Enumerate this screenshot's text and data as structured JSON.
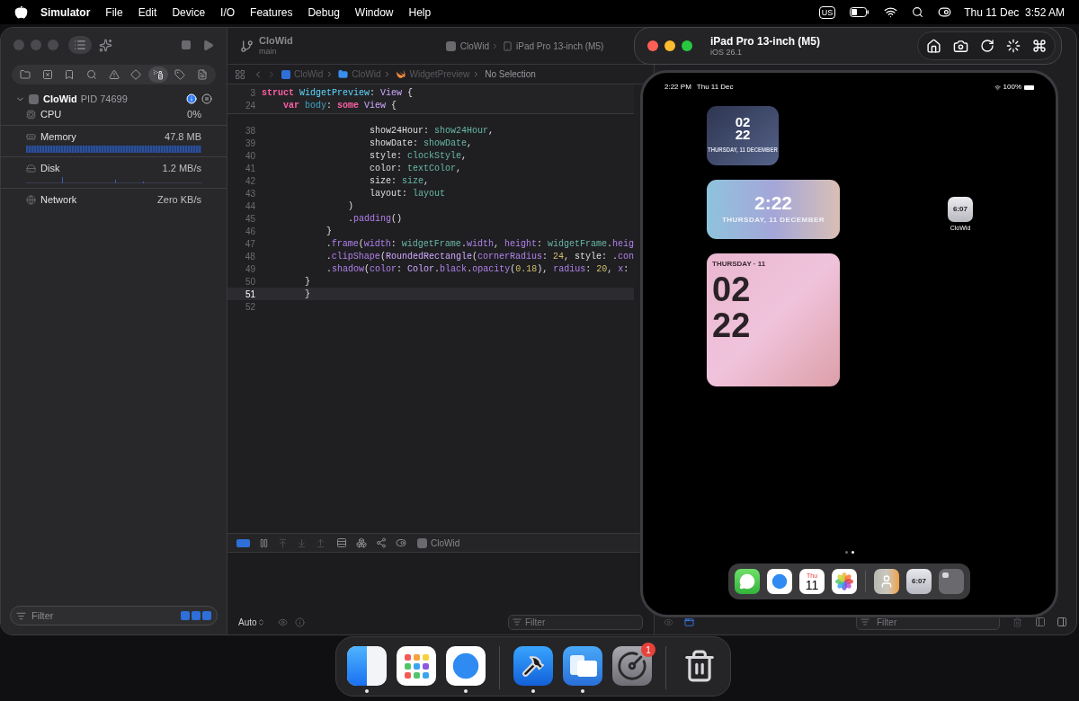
{
  "menu_bar": {
    "app_name": "Simulator",
    "menus": [
      "File",
      "Edit",
      "Device",
      "I/O",
      "Features",
      "Debug",
      "Window",
      "Help"
    ],
    "input_source": "US",
    "clock": "Thu 11 Dec  3:52 AM"
  },
  "xcode": {
    "navigator_tabs": [
      {
        "kind": "folder",
        "selected": false
      },
      {
        "kind": "source",
        "selected": false
      },
      {
        "kind": "bookmark",
        "selected": false
      },
      {
        "kind": "search",
        "selected": false
      },
      {
        "kind": "issue",
        "selected": false
      },
      {
        "kind": "test",
        "selected": false
      },
      {
        "kind": "debug",
        "selected": true
      },
      {
        "kind": "breakpoint",
        "selected": false
      },
      {
        "kind": "report",
        "selected": false
      }
    ],
    "process": {
      "name": "CloWid",
      "pid": "PID 74699",
      "expanded": true
    },
    "gauges": [
      {
        "name": "CPU",
        "value": "0%",
        "kind": "plain"
      },
      {
        "name": "Memory",
        "value": "47.8 MB",
        "kind": "bar"
      },
      {
        "name": "Disk",
        "value": "1.2 MB/s",
        "kind": "spikes"
      },
      {
        "name": "Network",
        "value": "Zero KB/s",
        "kind": "plain"
      }
    ],
    "navigator_filter": {
      "placeholder": "Filter"
    },
    "toolbar": {
      "project": "CloWid",
      "branch": "main",
      "scheme": "CloWid",
      "destination": "iPad Pro 13-inch (M5)"
    },
    "jump_bar": [
      {
        "kind": "project",
        "label": "CloWid"
      },
      {
        "kind": "folder",
        "label": "CloWid"
      },
      {
        "kind": "swift",
        "label": "WidgetPreview"
      },
      {
        "kind": "none",
        "label": "No Selection"
      }
    ],
    "sticky_lines": [
      {
        "number": "3",
        "segments": [
          {
            "kind": "keyword",
            "text": "struct "
          },
          {
            "kind": "decl",
            "text": "WidgetPreview"
          },
          {
            "kind": "plain",
            "text": ": "
          },
          {
            "kind": "type",
            "text": "View"
          },
          {
            "kind": "plain",
            "text": " {"
          }
        ]
      },
      {
        "number": "24",
        "segments": [
          {
            "kind": "keyword",
            "text": "    var "
          },
          {
            "kind": "var",
            "text": "body"
          },
          {
            "kind": "plain",
            "text": ": "
          },
          {
            "kind": "keyword",
            "text": "some "
          },
          {
            "kind": "type",
            "text": "View"
          },
          {
            "kind": "plain",
            "text": " {"
          }
        ]
      }
    ],
    "lines": [
      {
        "number": "38",
        "current": false,
        "segments": [
          {
            "kind": "plain",
            "text": "                    show24Hour: "
          },
          {
            "kind": "project",
            "text": "show24Hour"
          },
          {
            "kind": "plain",
            "text": ","
          }
        ]
      },
      {
        "number": "39",
        "current": false,
        "segments": [
          {
            "kind": "plain",
            "text": "                    showDate: "
          },
          {
            "kind": "project",
            "text": "showDate"
          },
          {
            "kind": "plain",
            "text": ","
          }
        ]
      },
      {
        "number": "40",
        "current": false,
        "segments": [
          {
            "kind": "plain",
            "text": "                    style: "
          },
          {
            "kind": "project",
            "text": "clockStyle"
          },
          {
            "kind": "plain",
            "text": ","
          }
        ]
      },
      {
        "number": "41",
        "current": false,
        "segments": [
          {
            "kind": "plain",
            "text": "                    color: "
          },
          {
            "kind": "project",
            "text": "textColor"
          },
          {
            "kind": "plain",
            "text": ","
          }
        ]
      },
      {
        "number": "42",
        "current": false,
        "segments": [
          {
            "kind": "plain",
            "text": "                    size: "
          },
          {
            "kind": "project",
            "text": "size"
          },
          {
            "kind": "plain",
            "text": ","
          }
        ]
      },
      {
        "number": "43",
        "current": false,
        "segments": [
          {
            "kind": "plain",
            "text": "                    layout: "
          },
          {
            "kind": "project",
            "text": "layout"
          }
        ]
      },
      {
        "number": "44",
        "current": false,
        "segments": [
          {
            "kind": "plain",
            "text": "                )"
          }
        ]
      },
      {
        "number": "45",
        "current": false,
        "segments": [
          {
            "kind": "plain",
            "text": "                ."
          },
          {
            "kind": "method",
            "text": "padding"
          },
          {
            "kind": "plain",
            "text": "()"
          }
        ]
      },
      {
        "number": "46",
        "current": false,
        "segments": [
          {
            "kind": "plain",
            "text": "            }"
          }
        ]
      },
      {
        "number": "47",
        "current": false,
        "segments": [
          {
            "kind": "plain",
            "text": "            ."
          },
          {
            "kind": "method",
            "text": "frame"
          },
          {
            "kind": "plain",
            "text": "("
          },
          {
            "kind": "method",
            "text": "width"
          },
          {
            "kind": "plain",
            "text": ": "
          },
          {
            "kind": "project",
            "text": "widgetFrame"
          },
          {
            "kind": "plain",
            "text": "."
          },
          {
            "kind": "method",
            "text": "width"
          },
          {
            "kind": "plain",
            "text": ", "
          },
          {
            "kind": "method",
            "text": "height"
          },
          {
            "kind": "plain",
            "text": ": "
          },
          {
            "kind": "project",
            "text": "widgetFrame"
          },
          {
            "kind": "plain",
            "text": "."
          },
          {
            "kind": "method",
            "text": "heig"
          }
        ]
      },
      {
        "number": "48",
        "current": false,
        "segments": [
          {
            "kind": "plain",
            "text": "            ."
          },
          {
            "kind": "method",
            "text": "clipShape"
          },
          {
            "kind": "plain",
            "text": "("
          },
          {
            "kind": "type",
            "text": "RoundedRectangle"
          },
          {
            "kind": "plain",
            "text": "("
          },
          {
            "kind": "method",
            "text": "cornerRadius"
          },
          {
            "kind": "plain",
            "text": ": "
          },
          {
            "kind": "number",
            "text": "24"
          },
          {
            "kind": "plain",
            "text": ", style: ."
          },
          {
            "kind": "method",
            "text": "con"
          }
        ]
      },
      {
        "number": "49",
        "current": false,
        "segments": [
          {
            "kind": "plain",
            "text": "            ."
          },
          {
            "kind": "method",
            "text": "shadow"
          },
          {
            "kind": "plain",
            "text": "("
          },
          {
            "kind": "method",
            "text": "color"
          },
          {
            "kind": "plain",
            "text": ": "
          },
          {
            "kind": "type",
            "text": "Color"
          },
          {
            "kind": "plain",
            "text": "."
          },
          {
            "kind": "method",
            "text": "black"
          },
          {
            "kind": "plain",
            "text": "."
          },
          {
            "kind": "method",
            "text": "opacity"
          },
          {
            "kind": "plain",
            "text": "("
          },
          {
            "kind": "number",
            "text": "0.18"
          },
          {
            "kind": "plain",
            "text": "), "
          },
          {
            "kind": "method",
            "text": "radius"
          },
          {
            "kind": "plain",
            "text": ": "
          },
          {
            "kind": "number",
            "text": "20"
          },
          {
            "kind": "plain",
            "text": ", "
          },
          {
            "kind": "method",
            "text": "x"
          },
          {
            "kind": "plain",
            "text": ":"
          }
        ]
      },
      {
        "number": "50",
        "current": false,
        "segments": [
          {
            "kind": "plain",
            "text": "        }"
          }
        ]
      },
      {
        "number": "51",
        "current": true,
        "segments": [
          {
            "kind": "plain",
            "text": "        }"
          }
        ]
      },
      {
        "number": "52",
        "current": false
      }
    ],
    "debug_bar": {
      "breakpoints_on": true,
      "target": "CloWid"
    },
    "console": {
      "mode": "Auto",
      "filter_placeholder": "Filter"
    },
    "variables": {
      "filter_placeholder": "Filter"
    }
  },
  "simulator": {
    "device": "iPad Pro 13-inch (M5)",
    "os": "iOS 26.1",
    "status_time": "2:22 PM",
    "status_date": "Thu 11 Dec",
    "battery": "100%",
    "widgets": [
      {
        "kind": "small",
        "hour": "02",
        "minute": "22",
        "date": "THURSDAY, 11 DECEMBER"
      },
      {
        "kind": "medium",
        "time": "2:22",
        "date": "THURSDAY, 11 DECEMBER"
      },
      {
        "kind": "large",
        "date": "THURSDAY · 11",
        "hour": "02",
        "minute": "22"
      }
    ],
    "app_icon": {
      "time": "6:07",
      "label": "CloWid"
    },
    "pages": [
      {
        "selected": false
      },
      {
        "selected": true
      }
    ],
    "dock": [
      {
        "kind": "messages"
      },
      {
        "kind": "safari"
      },
      {
        "kind": "calendar",
        "day": "Thu",
        "date": "11"
      },
      {
        "kind": "photos"
      },
      {
        "kind": "separator"
      },
      {
        "kind": "contacts"
      },
      {
        "kind": "clock",
        "time": "6:07"
      },
      {
        "kind": "folder"
      }
    ]
  },
  "dock": [
    {
      "kind": "finder",
      "running": true
    },
    {
      "kind": "launchpad",
      "running": false
    },
    {
      "kind": "safari",
      "running": true
    },
    {
      "kind": "separator"
    },
    {
      "kind": "xcode",
      "running": true
    },
    {
      "kind": "simulator",
      "running": true
    },
    {
      "kind": "settings",
      "running": false,
      "badge": "1"
    },
    {
      "kind": "separator"
    },
    {
      "kind": "trash",
      "running": false
    }
  ]
}
